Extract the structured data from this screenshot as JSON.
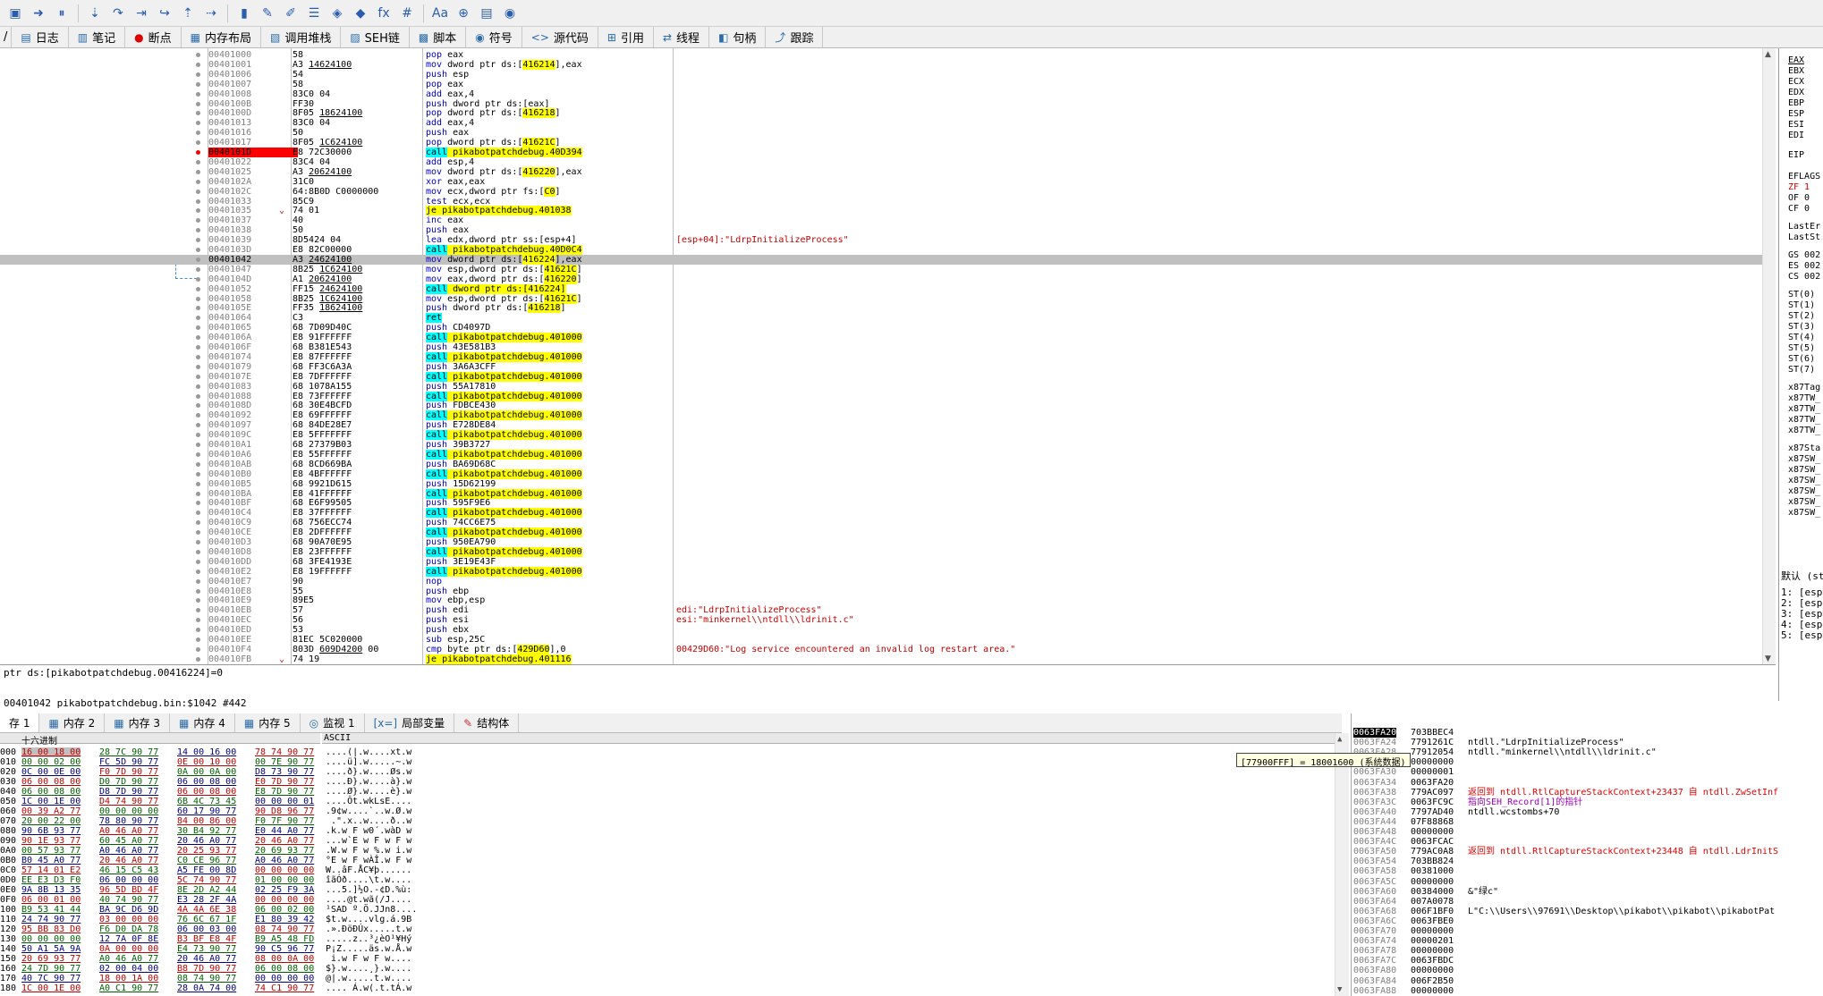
{
  "toolbar": {
    "icons": [
      "save-icon",
      "arrow-right-icon",
      "pause-icon",
      "step-into-icon",
      "step-over-icon",
      "run-to-icon",
      "animate-icon",
      "step-out-icon",
      "run-until-icon",
      "book-icon",
      "trace-icon",
      "pen-icon",
      "notes-icon",
      "patch-icon",
      "erase-icon",
      "fx-icon",
      "hash-icon",
      "font-icon",
      "pin-icon",
      "calc-icon",
      "globe-icon"
    ]
  },
  "tabs": [
    {
      "label": "日志",
      "icon": "log-icon"
    },
    {
      "label": "笔记",
      "icon": "note-icon"
    },
    {
      "label": "断点",
      "icon": "breakpoint-icon"
    },
    {
      "label": "内存布局",
      "icon": "memory-map-icon"
    },
    {
      "label": "调用堆栈",
      "icon": "call-stack-icon"
    },
    {
      "label": "SEH链",
      "icon": "seh-icon"
    },
    {
      "label": "脚本",
      "icon": "script-icon"
    },
    {
      "label": "符号",
      "icon": "symbol-icon"
    },
    {
      "label": "源代码",
      "icon": "source-icon"
    },
    {
      "label": "引用",
      "icon": "reference-icon"
    },
    {
      "label": "线程",
      "icon": "thread-icon"
    },
    {
      "label": "句柄",
      "icon": "handle-icon"
    },
    {
      "label": "跟踪",
      "icon": "trace-icon"
    }
  ],
  "tab_prefix": "/",
  "disasm": [
    {
      "a": "00401000",
      "b": "58",
      "i": "pop eax"
    },
    {
      "a": "00401001",
      "b": "A3 14624100",
      "bu": "14624100",
      "i": "mov dword ptr ds:[416214],eax"
    },
    {
      "a": "00401006",
      "b": "54",
      "i": "push esp"
    },
    {
      "a": "00401007",
      "b": "58",
      "i": "pop eax"
    },
    {
      "a": "00401008",
      "b": "83C0 04",
      "i": "add eax,4"
    },
    {
      "a": "0040100B",
      "b": "FF30",
      "i": "push dword ptr ds:[eax]"
    },
    {
      "a": "0040100D",
      "b": "8F05 18624100",
      "bu": "18624100",
      "i": "pop dword ptr ds:[416218]"
    },
    {
      "a": "00401013",
      "b": "83C0 04",
      "i": "add eax,4"
    },
    {
      "a": "00401016",
      "b": "50",
      "i": "push eax"
    },
    {
      "a": "00401017",
      "b": "8F05 1C624100",
      "bu": "1C624100",
      "i": "pop dword ptr ds:[41621C]"
    },
    {
      "a": "0040101D",
      "b": "E8 72C30000",
      "i": "call pikabotpatchdebug.40D394",
      "t": "call",
      "bp": true
    },
    {
      "a": "00401022",
      "b": "83C4 04",
      "i": "add esp,4"
    },
    {
      "a": "00401025",
      "b": "A3 20624100",
      "bu": "20624100",
      "i": "mov dword ptr ds:[416220],eax"
    },
    {
      "a": "0040102A",
      "b": "31C0",
      "i": "xor eax,eax"
    },
    {
      "a": "0040102C",
      "b": "64:8B0D C0000000",
      "i": "mov ecx,dword ptr fs:[C0]"
    },
    {
      "a": "00401033",
      "b": "85C9",
      "i": "test ecx,ecx"
    },
    {
      "a": "00401035",
      "b": "74 01",
      "i": "je pikabotpatchdebug.401038",
      "t": "jmp"
    },
    {
      "a": "00401037",
      "b": "40",
      "i": "inc eax"
    },
    {
      "a": "00401038",
      "b": "50",
      "i": "push eax"
    },
    {
      "a": "00401039",
      "b": "8D5424 04",
      "i": "lea edx,dword ptr ss:[esp+4]",
      "c": "[esp+04]:\"LdrpInitializeProcess\""
    },
    {
      "a": "0040103D",
      "b": "E8 82C00000",
      "i": "call pikabotpatchdebug.40D0C4",
      "t": "call"
    },
    {
      "a": "00401042",
      "b": "A3 24624100",
      "bu": "24624100",
      "i": "mov dword ptr ds:[416224],eax",
      "sel": true
    },
    {
      "a": "00401047",
      "b": "8B25 1C624100",
      "bu": "1C624100",
      "i": "mov esp,dword ptr ds:[41621C]"
    },
    {
      "a": "0040104D",
      "b": "A1 20624100",
      "bu": "20624100",
      "i": "mov eax,dword ptr ds:[416220]"
    },
    {
      "a": "00401052",
      "b": "FF15 24624100",
      "bu": "24624100",
      "i": "call dword ptr ds:[416224]",
      "t": "call"
    },
    {
      "a": "00401058",
      "b": "8B25 1C624100",
      "bu": "1C624100",
      "i": "mov esp,dword ptr ds:[41621C]"
    },
    {
      "a": "0040105E",
      "b": "FF35 18624100",
      "bu": "18624100",
      "i": "push dword ptr ds:[416218]"
    },
    {
      "a": "00401064",
      "b": "C3",
      "i": "ret",
      "t": "ret"
    },
    {
      "a": "00401065",
      "b": "68 7D09D40C",
      "i": "push CD4097D"
    },
    {
      "a": "0040106A",
      "b": "E8 91FFFFFF",
      "i": "call pikabotpatchdebug.401000",
      "t": "call"
    },
    {
      "a": "0040106F",
      "b": "68 B381E543",
      "i": "push 43E581B3"
    },
    {
      "a": "00401074",
      "b": "E8 87FFFFFF",
      "i": "call pikabotpatchdebug.401000",
      "t": "call"
    },
    {
      "a": "00401079",
      "b": "68 FF3C6A3A",
      "i": "push 3A6A3CFF"
    },
    {
      "a": "0040107E",
      "b": "E8 7DFFFFFF",
      "i": "call pikabotpatchdebug.401000",
      "t": "call"
    },
    {
      "a": "00401083",
      "b": "68 1078A155",
      "i": "push 55A17810"
    },
    {
      "a": "00401088",
      "b": "E8 73FFFFFF",
      "i": "call pikabotpatchdebug.401000",
      "t": "call"
    },
    {
      "a": "0040108D",
      "b": "68 30E4BCFD",
      "i": "push FDBCE430"
    },
    {
      "a": "00401092",
      "b": "E8 69FFFFFF",
      "i": "call pikabotpatchdebug.401000",
      "t": "call"
    },
    {
      "a": "00401097",
      "b": "68 84DE28E7",
      "i": "push E728DE84"
    },
    {
      "a": "0040109C",
      "b": "E8 5FFFFFFF",
      "i": "call pikabotpatchdebug.401000",
      "t": "call"
    },
    {
      "a": "004010A1",
      "b": "68 27379B03",
      "i": "push 39B3727"
    },
    {
      "a": "004010A6",
      "b": "E8 55FFFFFF",
      "i": "call pikabotpatchdebug.401000",
      "t": "call"
    },
    {
      "a": "004010AB",
      "b": "68 8CD669BA",
      "i": "push BA69D68C"
    },
    {
      "a": "004010B0",
      "b": "E8 4BFFFFFF",
      "i": "call pikabotpatchdebug.401000",
      "t": "call"
    },
    {
      "a": "004010B5",
      "b": "68 9921D615",
      "i": "push 15D62199"
    },
    {
      "a": "004010BA",
      "b": "E8 41FFFFFF",
      "i": "call pikabotpatchdebug.401000",
      "t": "call"
    },
    {
      "a": "004010BF",
      "b": "68 E6F99505",
      "i": "push 595F9E6"
    },
    {
      "a": "004010C4",
      "b": "E8 37FFFFFF",
      "i": "call pikabotpatchdebug.401000",
      "t": "call"
    },
    {
      "a": "004010C9",
      "b": "68 756ECC74",
      "i": "push 74CC6E75"
    },
    {
      "a": "004010CE",
      "b": "E8 2DFFFFFF",
      "i": "call pikabotpatchdebug.401000",
      "t": "call"
    },
    {
      "a": "004010D3",
      "b": "68 90A70E95",
      "i": "push 950EA790"
    },
    {
      "a": "004010D8",
      "b": "E8 23FFFFFF",
      "i": "call pikabotpatchdebug.401000",
      "t": "call"
    },
    {
      "a": "004010DD",
      "b": "68 3FE4193E",
      "i": "push 3E19E43F"
    },
    {
      "a": "004010E2",
      "b": "E8 19FFFFFF",
      "i": "call pikabotpatchdebug.401000",
      "t": "call"
    },
    {
      "a": "004010E7",
      "b": "90",
      "i": "nop"
    },
    {
      "a": "004010E8",
      "b": "55",
      "i": "push ebp"
    },
    {
      "a": "004010E9",
      "b": "89E5",
      "i": "mov ebp,esp"
    },
    {
      "a": "004010EB",
      "b": "57",
      "i": "push edi",
      "c": "edi:\"LdrpInitializeProcess\""
    },
    {
      "a": "004010EC",
      "b": "56",
      "i": "push esi",
      "c": "esi:\"minkernel\\\\ntdll\\\\ldrinit.c\""
    },
    {
      "a": "004010ED",
      "b": "53",
      "i": "push ebx"
    },
    {
      "a": "004010EE",
      "b": "81EC 5C020000",
      "i": "sub esp,25C"
    },
    {
      "a": "004010F4",
      "b": "803D 609D4200 00",
      "bu": "609D4200",
      "i": "cmp byte ptr ds:[429D60],0",
      "c": "00429D60:\"Log service encountered an invalid log restart area.\""
    },
    {
      "a": "004010FB",
      "b": "74 19",
      "i": "je pikabotpatchdebug.401116",
      "t": "jmp"
    }
  ],
  "registers": {
    "gpr": [
      "EAX",
      "EBX",
      "ECX",
      "EDX",
      "EBP",
      "ESP",
      "ESI",
      "EDI"
    ],
    "eip": "EIP",
    "flags": [
      "EFLAGS",
      "ZF 1",
      "OF 0",
      "CF 0"
    ],
    "last": [
      "LastEr",
      "LastSt"
    ],
    "seg": [
      "GS 002",
      "ES 002",
      "CS 002"
    ],
    "st": [
      "ST(0)",
      "ST(1)",
      "ST(2)",
      "ST(3)",
      "ST(4)",
      "ST(5)",
      "ST(6)",
      "ST(7)"
    ],
    "x87tag": [
      "x87Tag",
      "x87TW_",
      "x87TW_",
      "x87TW_",
      "x87TW_"
    ],
    "x87sta": [
      "x87Sta",
      "x87SW_",
      "x87SW_",
      "x87SW_",
      "x87SW_",
      "x87SW_",
      "x87SW_"
    ]
  },
  "callconv": {
    "header": "默认 (st",
    "args": [
      "1: [esp",
      "2: [esp",
      "3: [esp",
      "4: [esp",
      "5: [esp"
    ]
  },
  "info": {
    "line1": "ptr ds:[pikabotpatchdebug.00416224]=0",
    "line2": "00401042 pikabotpatchdebug.bin:$1042 #442"
  },
  "dump_tabs": [
    {
      "label": "存 1",
      "icon": "memory-icon"
    },
    {
      "label": "内存 2",
      "icon": "memory-icon"
    },
    {
      "label": "内存 3",
      "icon": "memory-icon"
    },
    {
      "label": "内存 4",
      "icon": "memory-icon"
    },
    {
      "label": "内存 5",
      "icon": "memory-icon"
    },
    {
      "label": "监视 1",
      "icon": "watch-icon"
    },
    {
      "label": "局部变量",
      "icon": "locals-icon"
    },
    {
      "label": "结构体",
      "icon": "struct-icon"
    }
  ],
  "dump": {
    "hex_header": "十六进制",
    "ascii_header": "ASCII",
    "rows": [
      {
        "a": "000",
        "h": [
          "16 00 18 00",
          "28 7C 90 77",
          "14 00 16 00",
          "78 74 90 77"
        ],
        "s": "....(|.w....xt.w"
      },
      {
        "a": "010",
        "h": [
          "00 00 02 00",
          "FC 5D 90 77",
          "0E 00 10 00",
          "00 7E 90 77"
        ],
        "s": "....ü].w.....~.w"
      },
      {
        "a": "020",
        "h": [
          "0C 00 0E 00",
          "F0 7D 90 77",
          "0A 00 0A 00",
          "D8 73 90 77"
        ],
        "s": "....ð}.w....Øs.w"
      },
      {
        "a": "030",
        "h": [
          "06 00 08 00",
          "D0 7D 90 77",
          "06 00 08 00",
          "E0 7D 90 77"
        ],
        "s": "....Ð}.w....à}.w"
      },
      {
        "a": "040",
        "h": [
          "06 00 08 00",
          "D8 7D 90 77",
          "06 00 08 00",
          "E8 7D 90 77"
        ],
        "s": "....Ø}.w....è}.w"
      },
      {
        "a": "050",
        "h": [
          "1C 00 1E 00",
          "D4 74 90 77",
          "6B 4C 73 45",
          "00 00 00 01"
        ],
        "s": "....Ôt.wkLsE...."
      },
      {
        "a": "060",
        "h": [
          "00 39 A2 77",
          "00 00 00 00",
          "60 17 90 77",
          "90 D8 96 77"
        ],
        "s": ".9¢w....`..w.Ø.w"
      },
      {
        "a": "070",
        "h": [
          "20 00 22 00",
          "78 80 90 77",
          "84 00 86 00",
          "F0 7F 90 77"
        ],
        "s": " .\".x..w....ð..w"
      },
      {
        "a": "080",
        "h": [
          "90 6B 93 77",
          "A0 46 A0 77",
          "30 B4 92 77",
          "E0 44 A0 77"
        ],
        "s": ".k.w F w0´.wàD w"
      },
      {
        "a": "090",
        "h": [
          "90 1E 93 77",
          "60 45 A0 77",
          "20 46 A0 77",
          "20 46 A0 77"
        ],
        "s": "...w`E w F w F w"
      },
      {
        "a": "0A0",
        "h": [
          "00 57 93 77",
          "A0 46 A0 77",
          "20 25 93 77",
          "20 69 93 77"
        ],
        "s": ".W.w F w %.w i.w"
      },
      {
        "a": "0B0",
        "h": [
          "B0 45 A0 77",
          "20 46 A0 77",
          "C0 CE 96 77",
          "A0 46 A0 77"
        ],
        "s": "°E w F wÀÎ.w F w"
      },
      {
        "a": "0C0",
        "h": [
          "57 14 01 E2",
          "46 15 C5 43",
          "A5 FE 00 8D",
          "00 00 00 00"
        ],
        "s": "W..âF.ÅC¥þ......"
      },
      {
        "a": "0D0",
        "h": [
          "EE E3 D3 F0",
          "06 00 00 00",
          "5C 74 90 77",
          "01 00 00 00"
        ],
        "s": "îãÓð....\\t.w...."
      },
      {
        "a": "0E0",
        "h": [
          "9A 8B 13 35",
          "96 5D BD 4F",
          "8E 2D A2 44",
          "02 25 F9 3A"
        ],
        "s": "...5.]½O.-¢D.%ù:"
      },
      {
        "a": "0F0",
        "h": [
          "06 00 01 00",
          "40 74 90 77",
          "E3 28 2F 4A",
          "00 00 00 00"
        ],
        "s": "....@t.wã(/J...."
      },
      {
        "a": "100",
        "h": [
          "B9 53 41 44",
          "BA 9C D6 9D",
          "4A 4A 6E 38",
          "06 00 02 00"
        ],
        "s": "¹SAD º.Ö.JJn8...."
      },
      {
        "a": "110",
        "h": [
          "24 74 90 77",
          "03 00 00 00",
          "76 6C 67 1F",
          "E1 80 39 42"
        ],
        "s": "$t.w....vlg.á.9B"
      },
      {
        "a": "120",
        "h": [
          "95 BB 83 D0",
          "F6 D0 DA 78",
          "06 00 03 00",
          "08 74 90 77"
        ],
        "s": ".».ÐöÐÚx.....t.w"
      },
      {
        "a": "130",
        "h": [
          "00 00 00 00",
          "12 7A 0F 8E",
          "B3 BF E8 4F",
          "B9 A5 48 FD"
        ],
        "s": ".....z..³¿èO¹¥Hý"
      },
      {
        "a": "140",
        "h": [
          "50 A1 5A 9A",
          "0A 00 00 00",
          "E4 73 90 77",
          "90 C5 96 77"
        ],
        "s": "P¡Z.....äs.w.Å.w"
      },
      {
        "a": "150",
        "h": [
          "20 69 93 77",
          "A0 46 A0 77",
          "20 46 A0 77",
          "08 00 0A 00"
        ],
        "s": " i.w F w F w...."
      },
      {
        "a": "160",
        "h": [
          "24 7D 90 77",
          "02 00 04 00",
          "B8 7D 90 77",
          "06 00 08 00"
        ],
        "s": "$}.w....¸}.w...."
      },
      {
        "a": "170",
        "h": [
          "40 7C 90 77",
          "18 00 1A 00",
          "08 74 90 77",
          "00 00 00 00"
        ],
        "s": "@|.w.....t.w...."
      },
      {
        "a": "180",
        "h": [
          "1C 00 1E 00",
          "A0 C1 90 77",
          "28 0A 74 00",
          "74 C1 90 77"
        ],
        "s": ".... Á.w(.t.tÁ.w"
      }
    ]
  },
  "tooltip": "[77900FFF] = 18001600 (系统数据)",
  "stack": [
    {
      "a": "0063FA20",
      "v": "703BBEC4",
      "c": "",
      "top": true
    },
    {
      "a": "0063FA24",
      "v": "7791261C",
      "c": "ntdll.\"LdrpInitializeProcess\""
    },
    {
      "a": "0063FA28",
      "v": "77912054",
      "c": "ntdll.\"minkernel\\\\ntdll\\\\ldrinit.c\""
    },
    {
      "a": "0063FA2C",
      "v": "00000000",
      "c": ""
    },
    {
      "a": "0063FA30",
      "v": "00000001",
      "c": ""
    },
    {
      "a": "0063FA34",
      "v": "0063FA20",
      "c": ""
    },
    {
      "a": "0063FA38",
      "v": "779AC097",
      "c": "返回到 ntdll.RtlCaptureStackContext+23437 自 ntdll.ZwSetInf",
      "k": "red"
    },
    {
      "a": "0063FA3C",
      "v": "0063FC9C",
      "c": "指向SEH_Record[1]的指针",
      "k": "purple"
    },
    {
      "a": "0063FA40",
      "v": "7797AD40",
      "c": "ntdll.wcstombs+70"
    },
    {
      "a": "0063FA44",
      "v": "07F88868",
      "c": ""
    },
    {
      "a": "0063FA48",
      "v": "00000000",
      "c": ""
    },
    {
      "a": "0063FA4C",
      "v": "0063FCAC",
      "c": ""
    },
    {
      "a": "0063FA50",
      "v": "779AC0A8",
      "c": "返回到 ntdll.RtlCaptureStackContext+23448 自 ntdll.LdrInitS",
      "k": "red"
    },
    {
      "a": "0063FA54",
      "v": "703BB824",
      "c": ""
    },
    {
      "a": "0063FA58",
      "v": "00381000",
      "c": ""
    },
    {
      "a": "0063FA5C",
      "v": "00000000",
      "c": ""
    },
    {
      "a": "0063FA60",
      "v": "00384000",
      "c": "&\"绿c\""
    },
    {
      "a": "0063FA64",
      "v": "007A0078",
      "c": ""
    },
    {
      "a": "0063FA68",
      "v": "006F1BF0",
      "c": "L\"C:\\\\Users\\\\97691\\\\Desktop\\\\pikabot\\\\pikabot\\\\pikabotPat"
    },
    {
      "a": "0063FA6C",
      "v": "0063FBE0",
      "c": ""
    },
    {
      "a": "0063FA70",
      "v": "00000000",
      "c": ""
    },
    {
      "a": "0063FA74",
      "v": "00000201",
      "c": ""
    },
    {
      "a": "0063FA78",
      "v": "00000000",
      "c": ""
    },
    {
      "a": "0063FA7C",
      "v": "0063FBDC",
      "c": ""
    },
    {
      "a": "0063FA80",
      "v": "00000000",
      "c": ""
    },
    {
      "a": "0063FA84",
      "v": "006F2B50",
      "c": ""
    },
    {
      "a": "0063FA88",
      "v": "00000000",
      "c": ""
    }
  ]
}
